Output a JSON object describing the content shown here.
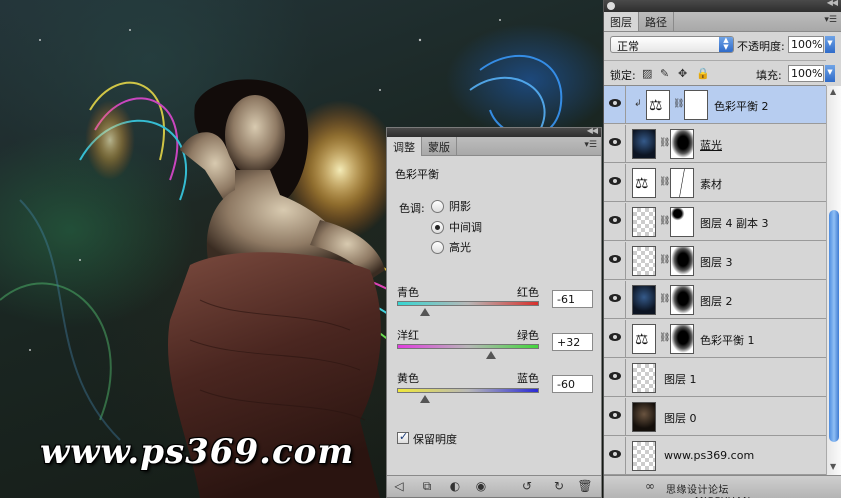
{
  "watermark": "www.ps369.com",
  "adjustments": {
    "tabs": [
      "调整",
      "蒙版"
    ],
    "title": "色彩平衡",
    "tone_label": "色调:",
    "tones": [
      "阴影",
      "中间调",
      "高光"
    ],
    "selected_tone": "中间调",
    "sliders": [
      {
        "left": "青色",
        "right": "红色",
        "value": "-61",
        "fraction": 0.2,
        "colors": [
          "#36d6d2",
          "#d8302c"
        ]
      },
      {
        "left": "洋红",
        "right": "绿色",
        "value": "+32",
        "fraction": 0.66,
        "colors": [
          "#e23ce0",
          "#42d63c"
        ]
      },
      {
        "left": "黄色",
        "right": "蓝色",
        "value": "-60",
        "fraction": 0.2,
        "colors": [
          "#f0e83a",
          "#2a2ad6"
        ]
      }
    ],
    "preserve_luminosity_label": "保留明度",
    "preserve_luminosity": true
  },
  "layers_panel": {
    "tabs": [
      "图层",
      "路径"
    ],
    "blend_mode": "正常",
    "opacity_label": "不透明度:",
    "opacity": "100%",
    "lock_label": "锁定:",
    "fill_label": "填充:",
    "fill": "100%",
    "layers": [
      {
        "name": "色彩平衡 2",
        "thumb": "adj",
        "mask": "white",
        "selected": true,
        "clipped": true
      },
      {
        "name": "蓝光",
        "thumb": "dark",
        "mask": "mask",
        "selected": false,
        "underline": true,
        "clipped": true
      },
      {
        "name": "素材",
        "thumb": "adj",
        "mask": "mask-line",
        "selected": false,
        "clipped": true
      },
      {
        "name": "图层 4 副本 3",
        "thumb": "checker",
        "mask": "mask-small",
        "selected": false
      },
      {
        "name": "图层 3",
        "thumb": "checker",
        "mask": "mask",
        "selected": false,
        "clipped": true
      },
      {
        "name": "图层 2",
        "thumb": "dark",
        "mask": "mask",
        "selected": false
      },
      {
        "name": "色彩平衡 1",
        "thumb": "adj",
        "mask": "mask",
        "selected": false
      },
      {
        "name": "图层 1",
        "thumb": "checker",
        "selected": false
      },
      {
        "name": "图层 0",
        "thumb": "photo",
        "selected": false
      },
      {
        "name": "www.ps369.com",
        "thumb": "checker",
        "selected": false
      }
    ],
    "footer_credit": "思缘设计论坛 www.MISSYUAN.com"
  },
  "icons": {
    "eye": "eye-icon",
    "chain": "link-icon",
    "panel_menu": "panel-menu-icon"
  }
}
